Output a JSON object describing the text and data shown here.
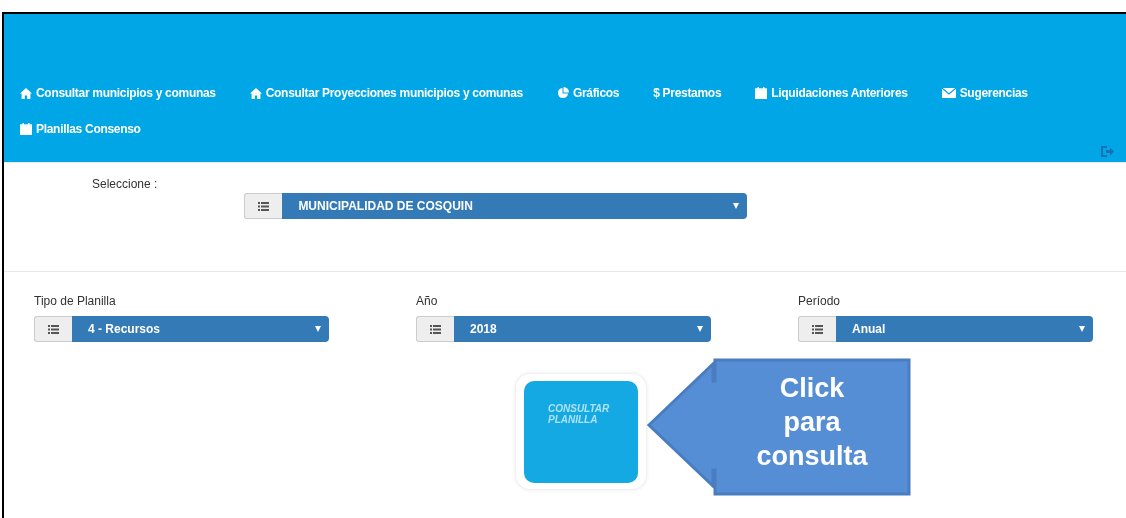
{
  "nav": {
    "items": [
      {
        "kind": "home",
        "label": "Consultar municipios y comunas"
      },
      {
        "kind": "home",
        "label": "Consultar Proyecciones municipios y comunas"
      },
      {
        "kind": "chart",
        "label": "Gráficos"
      },
      {
        "kind": "plain",
        "label": "$ Prestamos"
      },
      {
        "kind": "calendar",
        "label": "Liquidaciones Anteriores"
      },
      {
        "kind": "mail",
        "label": "Sugerencias"
      },
      {
        "kind": "calendar",
        "label": "Planillas Consenso"
      }
    ]
  },
  "municipality": {
    "label": "Seleccione :",
    "value": "MUNICIPALIDAD DE COSQUIN"
  },
  "filters": [
    {
      "label": "Tipo de Planilla",
      "value": "4 - Recursos"
    },
    {
      "label": "Año",
      "value": "2018"
    },
    {
      "label": "Período",
      "value": "Anual"
    }
  ],
  "query_button": {
    "label": "CONSULTAR PLANILLA"
  },
  "callout": {
    "text": "Click para consulta"
  }
}
